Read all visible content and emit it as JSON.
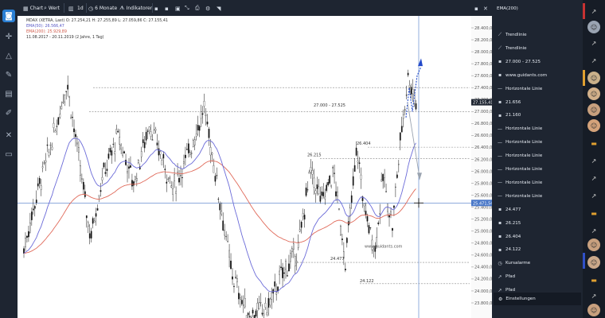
{
  "toolbar": {
    "chart_label": "Chart",
    "wert_label": "Wert",
    "interval_label": "1d",
    "range_label": "6 Monate",
    "indicators_label": "Indikatoren"
  },
  "legend": {
    "line1": "MDAX (XETRA, Last)  O: 27.254,21  H: 27.255,89  L: 27.059,86  C: 27.155,41",
    "line2": "EMA(50): 26.566,47",
    "line3": "EMA(200): 25.929,89",
    "line4": "11.08.2017 - 20.11.2019  (2 Jahre, 1 Tag)"
  },
  "chart_data": {
    "type": "candlestick",
    "title": "MDAX (XETRA, Last)",
    "period": "11.08.2017 - 20.11.2019",
    "ylim": [
      23600,
      28600
    ],
    "y_ticks": [
      23800,
      24000,
      24200,
      24400,
      24600,
      24800,
      25000,
      25200,
      25400,
      25600,
      25800,
      26000,
      26200,
      26400,
      26600,
      26800,
      27000,
      27200,
      27400,
      27600,
      27800,
      28000,
      28200,
      28400
    ],
    "y_tick_labels": [
      "23.800,00",
      "24.000,00",
      "24.200,00",
      "24.400,00",
      "24.600,00",
      "24.800,00",
      "25.000,00",
      "25.200,00",
      "25.400,00",
      "25.600,00",
      "25.800,00",
      "26.000,00",
      "26.200,00",
      "26.400,00",
      "26.600,00",
      "26.800,00",
      "27.000,00",
      "27.200,00",
      "27.400,00",
      "27.600,00",
      "27.800,00",
      "28.000,00",
      "28.200,00",
      "28.400,00"
    ],
    "last_close": 27155.41,
    "last_close_label": "27.155,41",
    "crosshair_value": 25471.54,
    "crosshair_label": "25.471,54",
    "ema50_last": 26566.47,
    "ema200_last": 25929.89,
    "horizontal_lines": [
      27400,
      27000,
      26404,
      26215,
      24477,
      24122
    ],
    "zone_label": "27.000 - 27.525",
    "price_labels": [
      "26.404",
      "26.215",
      "24.477",
      "24.122"
    ],
    "watermark": "www.guidants.com",
    "colors": {
      "candle": "#111111",
      "ema50": "#6b6bd8",
      "ema200": "#e06a5a",
      "forecast_up": "#2249c9",
      "forecast_down": "#9aa3b0",
      "support": "#888888"
    }
  },
  "right_panel": {
    "header": "EMA(200)",
    "items": [
      {
        "icon": "trendline-icon",
        "label": "Trendlinie"
      },
      {
        "icon": "trendline-icon",
        "label": "Trendlinie"
      },
      {
        "icon": "zone-icon",
        "label": "27.000 - 27.525"
      },
      {
        "icon": "text-icon",
        "label": "www.guidants.com"
      },
      {
        "icon": "hline-icon",
        "label": "Horizontale Linie"
      },
      {
        "icon": "text-icon",
        "label": "21.656"
      },
      {
        "icon": "text-icon",
        "label": "21.160"
      },
      {
        "icon": "hline-icon",
        "label": "Horizontale Linie"
      },
      {
        "icon": "hline-icon",
        "label": "Horizontale Linie"
      },
      {
        "icon": "hline-icon",
        "label": "Horizontale Linie"
      },
      {
        "icon": "hline-icon",
        "label": "Horizontale Linie"
      },
      {
        "icon": "hline-icon",
        "label": "Horizontale Linie"
      },
      {
        "icon": "hline-icon",
        "label": "Horizontale Linie"
      },
      {
        "icon": "text-icon",
        "label": "24.477"
      },
      {
        "icon": "text-icon",
        "label": "26.215"
      },
      {
        "icon": "text-icon",
        "label": "26.404"
      },
      {
        "icon": "text-icon",
        "label": "24.122"
      },
      {
        "icon": "alarm-icon",
        "label": "Kursalarme"
      },
      {
        "icon": "path-icon",
        "label": "Pfad"
      },
      {
        "icon": "path-icon",
        "label": "Pfad"
      }
    ],
    "settings_label": "Einstellungen"
  }
}
